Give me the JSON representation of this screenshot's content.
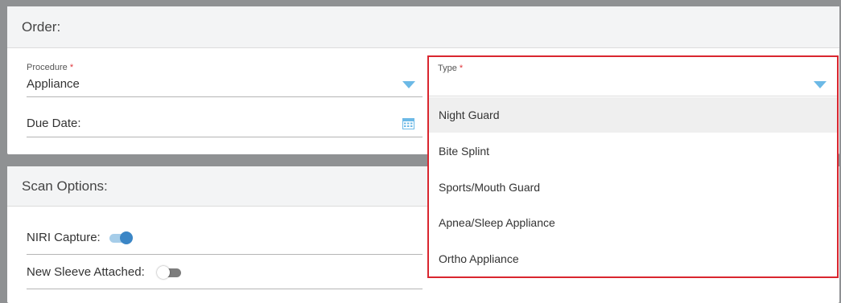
{
  "order": {
    "title": "Order:",
    "procedure": {
      "label": "Procedure",
      "required_mark": "*",
      "value": "Appliance"
    },
    "due_date": {
      "label": "Due Date:"
    }
  },
  "type_field": {
    "label": "Type",
    "required_mark": "*",
    "options": [
      "Night Guard",
      "Bite Splint",
      "Sports/Mouth Guard",
      "Apnea/Sleep Appliance",
      "Ortho Appliance"
    ],
    "highlighted_option": "Night Guard"
  },
  "scan_options": {
    "title": "Scan Options:",
    "niri_capture": {
      "label": "NIRI Capture:",
      "state": "on"
    },
    "new_sleeve": {
      "label": "New Sleeve Attached:",
      "state": "off"
    }
  },
  "colors": {
    "accent": "#6cb9e6",
    "toggle_on": "#3b86c6",
    "required": "#e0353b",
    "dropdown_border": "#d9262f"
  },
  "icons": [
    "chevron-down-icon",
    "calendar-icon"
  ]
}
